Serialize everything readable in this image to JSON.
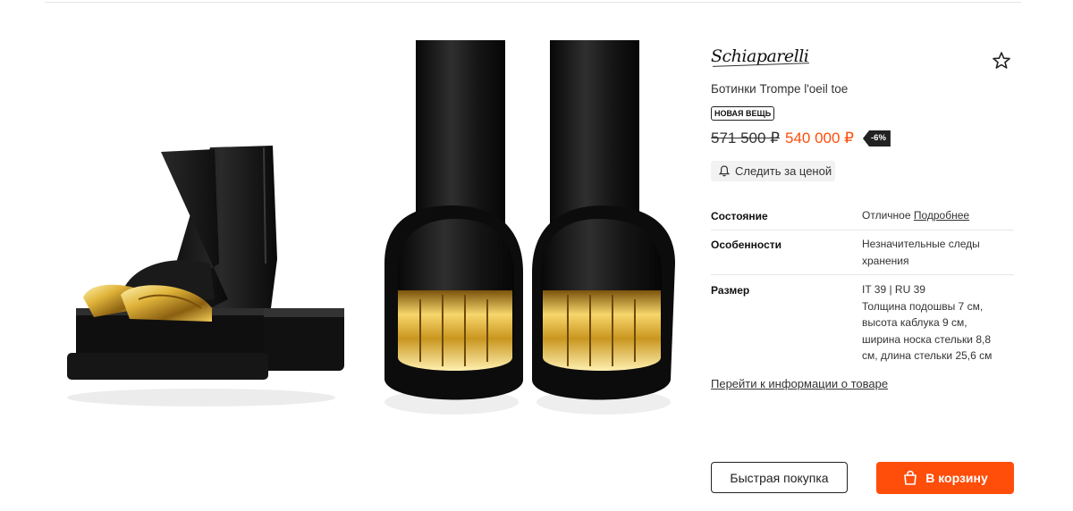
{
  "product": {
    "brand": "Schiaparelli",
    "title": "Ботинки Trompe l'oeil toe",
    "badge": "НОВАЯ ВЕЩЬ",
    "old_price": "571 500 ₽",
    "price": "540 000 ₽",
    "discount": "-6%",
    "follow_label": "Следить за ценой",
    "images": [
      "boots-side-view",
      "boots-front-view"
    ],
    "favorite_icon": "star-outline-icon"
  },
  "specs": [
    {
      "label": "Состояние",
      "value": "Отличное",
      "link": "Подробнее"
    },
    {
      "label": "Особенности",
      "value_lines": [
        "Незначительные следы",
        "хранения"
      ]
    },
    {
      "label": "Размер",
      "value_lines": [
        "IT 39 | RU 39",
        "Толщина подошвы 7 см,",
        "высота каблука 9 см,",
        "ширина носка стельки 8,8",
        "см, длина стельки 25,6 см"
      ]
    }
  ],
  "more_info_link": "Перейти к информации о товаре",
  "actions": {
    "quick_buy": "Быстрая покупка",
    "add_to_cart": "В корзину"
  },
  "colors": {
    "accent": "#ff4d0a",
    "text": "#222222",
    "follow_bg": "#f2f2f2",
    "discount_bg": "#222222"
  }
}
